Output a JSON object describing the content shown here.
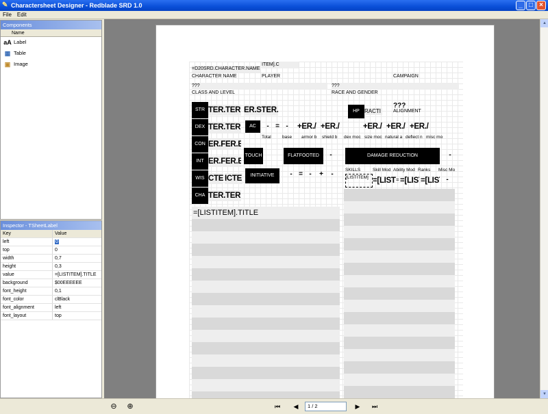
{
  "window": {
    "title": "Charactersheet Designer - Redblade SRD 1.0",
    "icon": "pen-icon",
    "min": "_",
    "max": "□",
    "close": "×"
  },
  "menu": [
    "File",
    "Edit"
  ],
  "components": {
    "header": "Components",
    "col_name": "Name",
    "items": [
      {
        "icon": "label-icon",
        "glyph": "aA",
        "label": "Label"
      },
      {
        "icon": "table-icon",
        "glyph": "▦",
        "label": "Table"
      },
      {
        "icon": "image-icon",
        "glyph": "▣",
        "label": "Image"
      }
    ]
  },
  "inspector": {
    "header": "Inspector - TSheetLabel",
    "col_key": "Key",
    "col_value": "Value",
    "rows": [
      {
        "key": "left",
        "value": "0"
      },
      {
        "key": "top",
        "value": "0"
      },
      {
        "key": "width",
        "value": "0,7"
      },
      {
        "key": "height",
        "value": "0,3"
      },
      {
        "key": "value",
        "value": "=[LISTITEM].TITLE"
      },
      {
        "key": "background",
        "value": "$00EEEEEE"
      },
      {
        "key": "font_height",
        "value": "0,1"
      },
      {
        "key": "font_color",
        "value": "clBlack"
      },
      {
        "key": "font_alignment",
        "value": "left"
      },
      {
        "key": "font_layout",
        "value": "top"
      }
    ]
  },
  "sheet": {
    "name_expr": "=D20SRD.CHARACTER.NAME",
    "listitem_frag": "ITEM].C",
    "lbl_character_name": "CHARACTER NAME",
    "lbl_player": "PLAYER",
    "lbl_campaign": "CAMPAIGN",
    "class_value": "???",
    "lbl_class_level": "CLASS AND LEVEL",
    "race_value": "???",
    "lbl_race_gender": "RACE AND GENDER",
    "alignment_value": "???",
    "lbl_alignment": "ALIGNMENT",
    "abilities": [
      {
        "abbr": "STR",
        "v1": "TER.TER",
        "v2": "ER.STER.S"
      },
      {
        "abbr": "DEX",
        "v1": "TER.TER",
        "v2": ""
      },
      {
        "abbr": "CON",
        "v1": "ER.FER.B",
        "v2": ""
      },
      {
        "abbr": "INT",
        "v1": "ER.FER.B",
        "v2": ""
      },
      {
        "abbr": "WIS",
        "v1": "CTE",
        "v2": "ICTE"
      },
      {
        "abbr": "CHA",
        "v1": "TER.TER",
        "v2": ""
      }
    ],
    "hp": "HP",
    "hp_frag": "RACTI",
    "ac": "AC",
    "ac_dash": "-",
    "ac_eq": "=",
    "ac_dash2": "-",
    "ac_vals": [
      "+ER./",
      "+ER./",
      "+ER./",
      "+ER./",
      "+ER./"
    ],
    "ac_labels": [
      "Total",
      "base",
      "armor b",
      "shield b",
      "dex moc",
      "size moc",
      "natural a",
      "deflect n",
      "misc mo"
    ],
    "touch": "TOUCH",
    "flatfooted": "FLATFOOTED",
    "ff_dash": "-",
    "damage_reduction": "DAMAGE REDUCTION",
    "dr_dash": "-",
    "initiative": "INITIATIVE",
    "init_parts": [
      "-",
      "=",
      "-",
      "+",
      "-"
    ],
    "skills_labels": [
      "SKILLS",
      "Skill Mod",
      "Ability Mod",
      "Ranks",
      "Misc Mo"
    ],
    "skills_listitem": "[LISTITEM]",
    "skills_vals": [
      "=[LIST",
      "=[LIST",
      "=[LIST"
    ],
    "skills_eq": "=",
    "skills_dash": "-",
    "list_title": "=[LISTITEM].TITLE"
  },
  "nav": {
    "first": "⏮",
    "prev": "◀",
    "page": "1 / 2",
    "next": "▶",
    "last": "⏭",
    "zoom_out": "zoom-out-icon",
    "zoom_in": "zoom-in-icon"
  }
}
